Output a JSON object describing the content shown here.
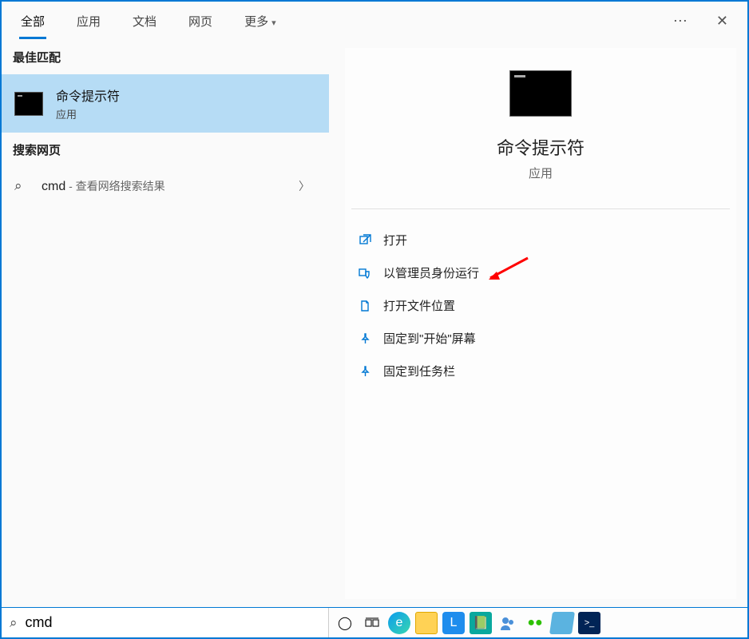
{
  "tabs": [
    {
      "label": "全部",
      "active": true
    },
    {
      "label": "应用",
      "active": false
    },
    {
      "label": "文档",
      "active": false
    },
    {
      "label": "网页",
      "active": false
    },
    {
      "label": "更多",
      "active": false,
      "dropdown": true
    }
  ],
  "sections": {
    "best_match": "最佳匹配",
    "web_search": "搜索网页"
  },
  "best_result": {
    "title": "命令提示符",
    "subtitle": "应用"
  },
  "web_result": {
    "query": "cmd",
    "suffix": " - 查看网络搜索结果"
  },
  "detail": {
    "title": "命令提示符",
    "subtitle": "应用"
  },
  "actions": [
    {
      "icon": "open",
      "label": "打开"
    },
    {
      "icon": "admin",
      "label": "以管理员身份运行"
    },
    {
      "icon": "folder",
      "label": "打开文件位置"
    },
    {
      "icon": "pin",
      "label": "固定到\"开始\"屏幕"
    },
    {
      "icon": "pin",
      "label": "固定到任务栏"
    }
  ],
  "search": {
    "value": "cmd"
  },
  "taskbar_icons": [
    "cortana",
    "task-view",
    "edge",
    "explorer",
    "app-blue",
    "app-teal",
    "people",
    "wechat",
    "notepad",
    "powershell"
  ]
}
